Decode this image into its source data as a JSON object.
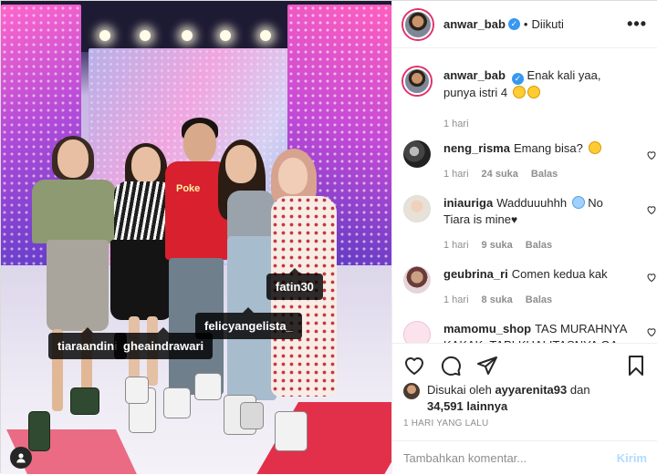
{
  "post": {
    "people_tags": [
      "tiaraandini",
      "gheaindrawari",
      "felicyangelista_",
      "fatin30"
    ]
  },
  "header": {
    "username": "anwar_bab",
    "follow_state": "Diikuti",
    "more_label": "•••"
  },
  "caption": {
    "username": "anwar_bab",
    "text": "Enak kali yaa, punya istri 4",
    "time": "1 hari"
  },
  "comments": [
    {
      "username": "neng_risma",
      "text": "Emang bisa?",
      "time": "1 hari",
      "likes": "24 suka",
      "reply": "Balas"
    },
    {
      "username": "iniauriga",
      "text": "Wadduuuhhh",
      "text2": "No Tiara is mine",
      "time": "1 hari",
      "likes": "9 suka",
      "reply": "Balas"
    },
    {
      "username": "geubrina_ri",
      "text": "Comen kedua kak",
      "time": "1 hari",
      "likes": "8 suka",
      "reply": "Balas"
    },
    {
      "username": "mamomu_shop",
      "text": "TAS MURAHNYA KAKAK, TAPI KUALITASNYA GA"
    }
  ],
  "likes": {
    "prefix": "Disukai oleh",
    "user": "ayyarenita93",
    "middle": "dan",
    "count": "34,591 lainnya"
  },
  "timestamp": "1 HARI YANG LALU",
  "composer": {
    "placeholder": "Tambahkan komentar...",
    "post_label": "Kirim"
  },
  "colors": {
    "verified": "#3897f0",
    "story_ring": "#e1306c",
    "post_disabled": "#b3dbff"
  }
}
